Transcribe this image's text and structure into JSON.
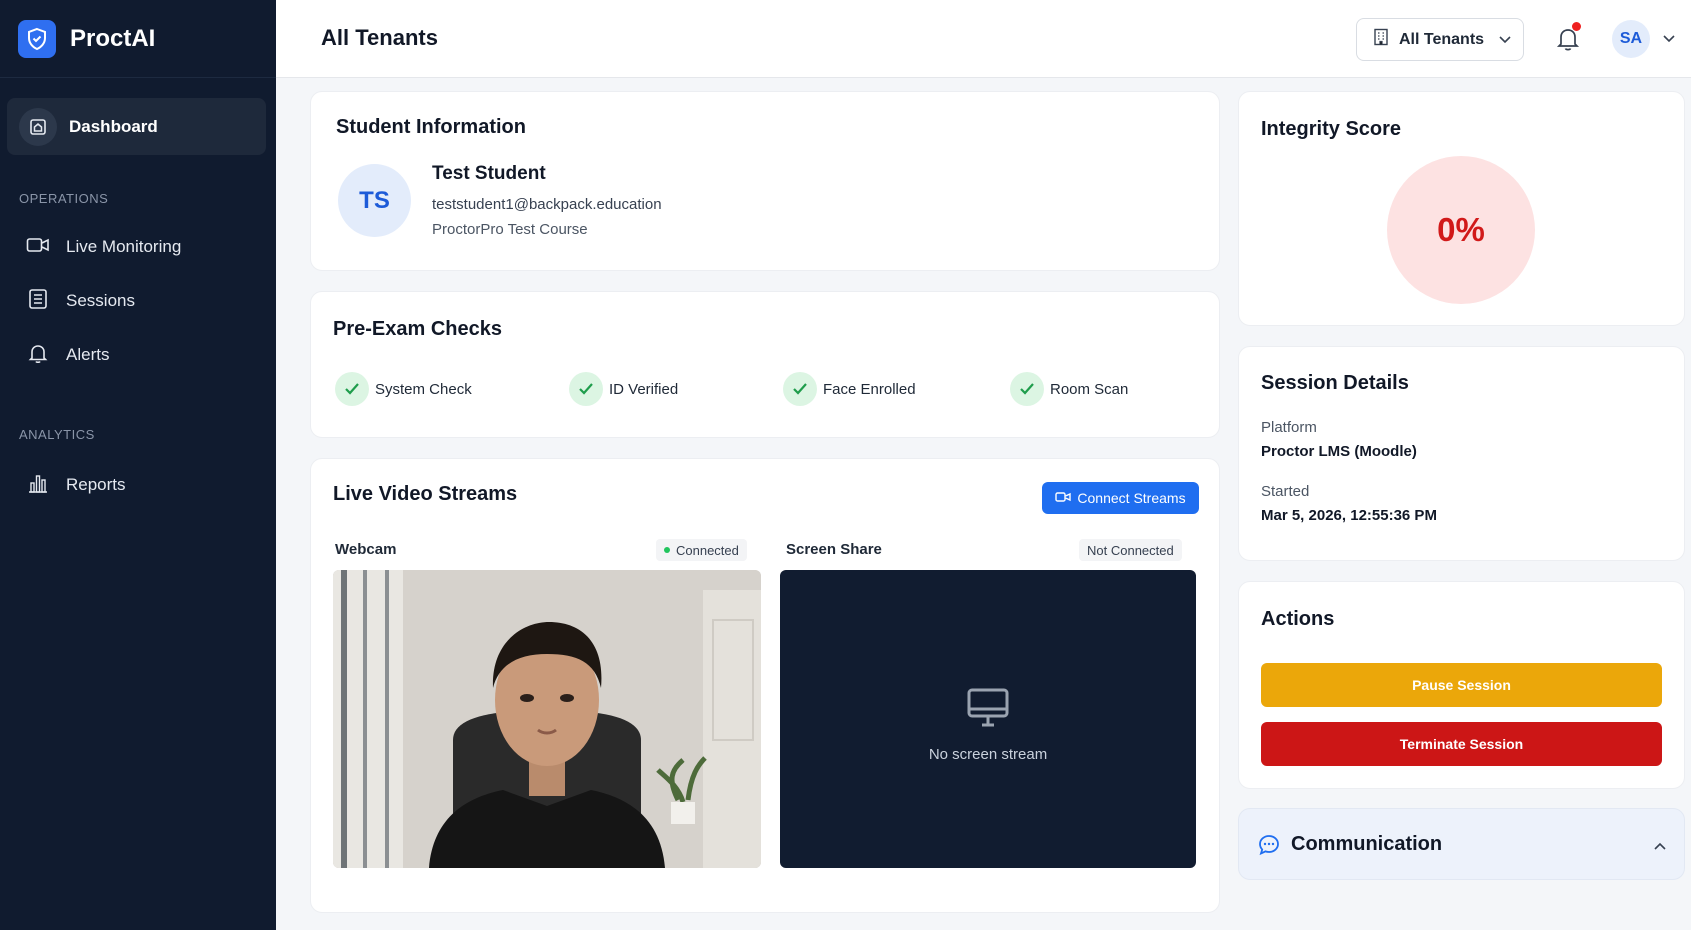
{
  "app": {
    "name": "ProctAI"
  },
  "sidebar": {
    "active_item": "Dashboard",
    "sections": [
      {
        "label": "OPERATIONS",
        "items": [
          "Live Monitoring",
          "Sessions",
          "Alerts"
        ]
      },
      {
        "label": "ANALYTICS",
        "items": [
          "Reports"
        ]
      }
    ]
  },
  "header": {
    "title": "All Tenants",
    "tenant_select": "All Tenants",
    "user_initials": "SA"
  },
  "student": {
    "card_title": "Student Information",
    "initials": "TS",
    "name": "Test Student",
    "email": "teststudent1@backpack.education",
    "course": "ProctorPro Test Course"
  },
  "pre_exam": {
    "title": "Pre-Exam Checks",
    "checks": [
      "System Check",
      "ID Verified",
      "Face Enrolled",
      "Room Scan"
    ]
  },
  "streams": {
    "title": "Live Video Streams",
    "connect_button": "Connect Streams",
    "webcam_label": "Webcam",
    "webcam_status": "Connected",
    "screen_label": "Screen Share",
    "screen_status": "Not Connected",
    "screen_placeholder": "No screen stream"
  },
  "integrity": {
    "title": "Integrity Score",
    "score": "0%"
  },
  "session": {
    "title": "Session Details",
    "platform_label": "Platform",
    "platform_value": "Proctor LMS (Moodle)",
    "started_label": "Started",
    "started_value": "Mar 5, 2026, 12:55:36 PM"
  },
  "actions": {
    "title": "Actions",
    "pause": "Pause Session",
    "terminate": "Terminate Session"
  },
  "communication": {
    "title": "Communication"
  },
  "colors": {
    "sidebar_bg": "#101b2f",
    "accent": "#1f6ef0",
    "pause": "#eba70a",
    "terminate": "#cc1616",
    "score": "#d11a1a"
  }
}
